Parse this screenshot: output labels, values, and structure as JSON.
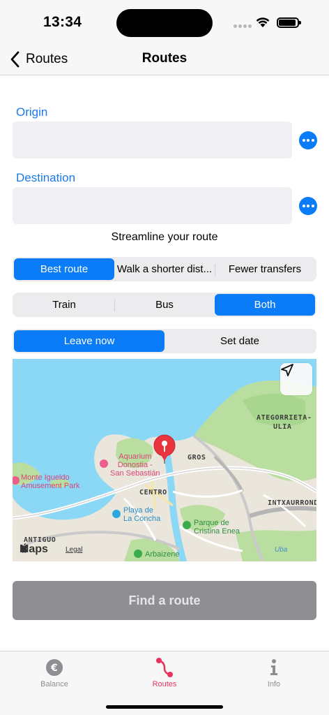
{
  "status": {
    "time": "13:34"
  },
  "nav": {
    "back_label": "Routes",
    "title": "Routes"
  },
  "form": {
    "origin": {
      "label": "Origin",
      "value": "",
      "placeholder": ""
    },
    "destination": {
      "label": "Destination",
      "value": "",
      "placeholder": ""
    },
    "caption": "Streamline your route"
  },
  "route_preference": {
    "options": [
      "Best route",
      "Walk a shorter dist...",
      "Fewer transfers"
    ],
    "selected": "Best route"
  },
  "transport_mode": {
    "options": [
      "Train",
      "Bus",
      "Both"
    ],
    "selected": "Both"
  },
  "departure": {
    "options": [
      "Leave now",
      "Set date"
    ],
    "selected": "Leave now"
  },
  "map": {
    "labels": {
      "ategorrieta": "ATEGORRIETA-",
      "ulia": "ULIA",
      "gros": "GROS",
      "centro": "CENTRO",
      "intxaurrondo": "INTXAURROND",
      "antiguo": "ANTIGUO",
      "uba": "Uba"
    },
    "pois": {
      "aquarium": "Aquarium\nDonostia -\nSan Sebastián",
      "monte_igueldo": "Monte Igueldo\nAmusement Park",
      "playa": "Playa de\nLa Concha",
      "parque": "Parque de\nCristina Enea",
      "arbaizene": "Arbaizene"
    },
    "brand": "Maps",
    "legal": "Legal",
    "colors": {
      "water": "#8ad7f6",
      "park": "#b9dea0",
      "land": "#eae6dc",
      "road": "#ffffff",
      "pin": "#e8353e"
    }
  },
  "actions": {
    "find_route": "Find a route"
  },
  "tabs": [
    {
      "label": "Balance",
      "icon": "euro-icon",
      "color": "#8e8e93"
    },
    {
      "label": "Routes",
      "icon": "route-icon",
      "color": "#e8345c"
    },
    {
      "label": "Info",
      "icon": "info-icon",
      "color": "#8e8e93"
    }
  ],
  "colors": {
    "accent": "#0a7cf7",
    "label_blue": "#1a7ae6",
    "tab_active": "#e8345c"
  }
}
